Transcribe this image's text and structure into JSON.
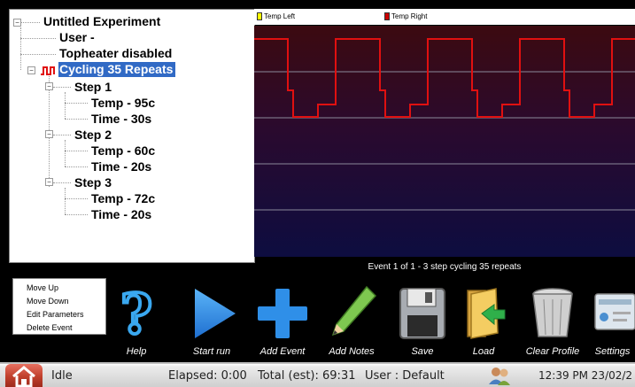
{
  "tree": {
    "root": "Untitled Experiment",
    "user": "User -",
    "topheater": "Topheater disabled",
    "cycling": "Cycling 35 Repeats",
    "steps": [
      {
        "label": "Step 1",
        "temp": "Temp - 95c",
        "time": "Time - 30s"
      },
      {
        "label": "Step 2",
        "temp": "Temp - 60c",
        "time": "Time - 20s"
      },
      {
        "label": "Step 3",
        "temp": "Temp - 72c",
        "time": "Time - 20s"
      }
    ]
  },
  "legend": {
    "left_label": "Temp Left",
    "left_color": "#ffff00",
    "right_label": "Temp Right",
    "right_color": "#cc0000"
  },
  "event_caption": "Event 1 of 1 - 3 step cycling 35 repeats",
  "context_menu": [
    "Move Up",
    "Move Down",
    "Edit Parameters",
    "Delete Event"
  ],
  "toolbar": {
    "help": "Help",
    "start_run": "Start run",
    "add_event": "Add Event",
    "add_notes": "Add Notes",
    "save": "Save",
    "load": "Load",
    "clear_profile": "Clear Profile",
    "settings": "Settings"
  },
  "status": {
    "state": "Idle",
    "elapsed": "Elapsed: 0:00",
    "total": "Total (est): 69:31",
    "user": "User : Default",
    "datetime": "12:39 PM 23/02/2"
  },
  "colors": {
    "trace": "#e01010",
    "tree_selection": "#316ac5",
    "accent_blue": "#2f8fe8"
  },
  "icons": {
    "help": "question-mark-icon",
    "start_run": "play-icon",
    "add_event": "plus-icon",
    "add_notes": "pencil-icon",
    "save": "floppy-disk-icon",
    "load": "folder-icon",
    "clear_profile": "trash-bin-icon",
    "settings": "settings-icon",
    "home": "home-icon",
    "users": "users-icon"
  }
}
